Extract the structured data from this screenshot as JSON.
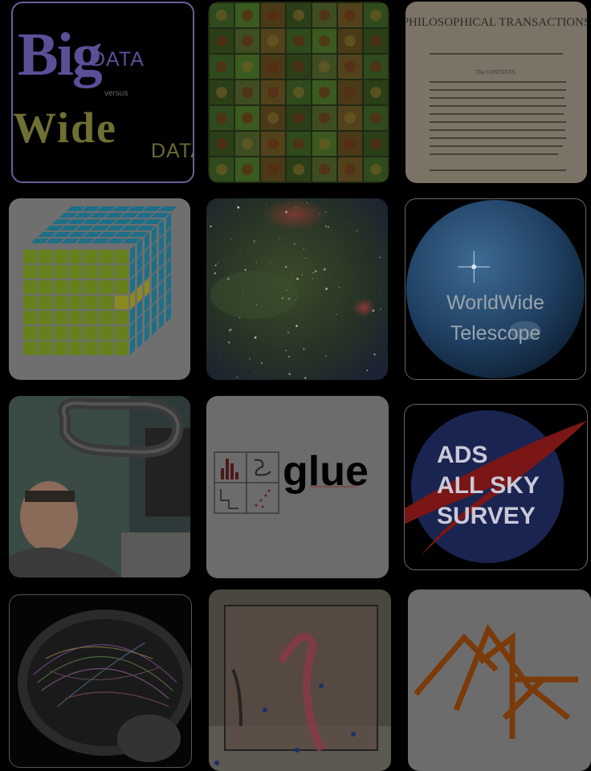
{
  "tiles": [
    {
      "id": "big-data-wide-data",
      "big": "Big",
      "data1": "DATA",
      "versus": "versus",
      "wide": "Wide",
      "data2": "DATA"
    },
    {
      "id": "microscopy-grid"
    },
    {
      "id": "philosophical-transactions",
      "heading": "PHILOSOPHICAL TRANSACTIONS",
      "subheading": "The CONTENTS."
    },
    {
      "id": "data-cube"
    },
    {
      "id": "galaxy-nebula"
    },
    {
      "id": "worldwide-telescope",
      "line1": "WorldWide",
      "line2": "Telescope"
    },
    {
      "id": "linked-data-portrait"
    },
    {
      "id": "glue",
      "title": "glue",
      "subtitle": "multidimensional data exploration"
    },
    {
      "id": "ads-all-sky-survey",
      "line1": "ADS",
      "line2": "ALL SKY",
      "line3": "SURVEY"
    },
    {
      "id": "brain-tractography"
    },
    {
      "id": "3d-printed-model"
    },
    {
      "id": "logo-mark"
    }
  ]
}
